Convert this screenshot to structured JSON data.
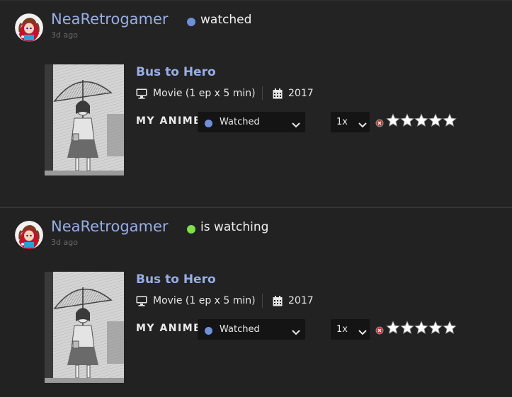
{
  "colors": {
    "username": "#98aee6",
    "anime_title": "#98aee6",
    "watched_dot": "#6f8fd8",
    "watching_dot": "#7ee04a",
    "background": "#232323",
    "select_bg": "#141414"
  },
  "feed": [
    {
      "username": "NeaRetrogamer",
      "status_text": "watched",
      "status_dot_color": "#6f8fd8",
      "time_ago": "3d ago",
      "anime_title": "Bus to Hero",
      "media_type": "Movie (1 ep x 5 min)",
      "year": "2017",
      "my_anime_label": "MY ANIME:",
      "list_status": "Watched",
      "rewatch_count": "1x",
      "rating_stars": 0
    },
    {
      "username": "NeaRetrogamer",
      "status_text": "is watching",
      "status_dot_color": "#7ee04a",
      "time_ago": "3d ago",
      "anime_title": "Bus to Hero",
      "media_type": "Movie (1 ep x 5 min)",
      "year": "2017",
      "my_anime_label": "MY ANIME:",
      "list_status": "Watched",
      "rewatch_count": "1x",
      "rating_stars": 0
    }
  ],
  "icons": {
    "monitor": "monitor-icon",
    "calendar": "calendar-icon",
    "chevron": "chevron-down-icon",
    "clear": "clear-rating-icon",
    "star": "star-icon"
  }
}
